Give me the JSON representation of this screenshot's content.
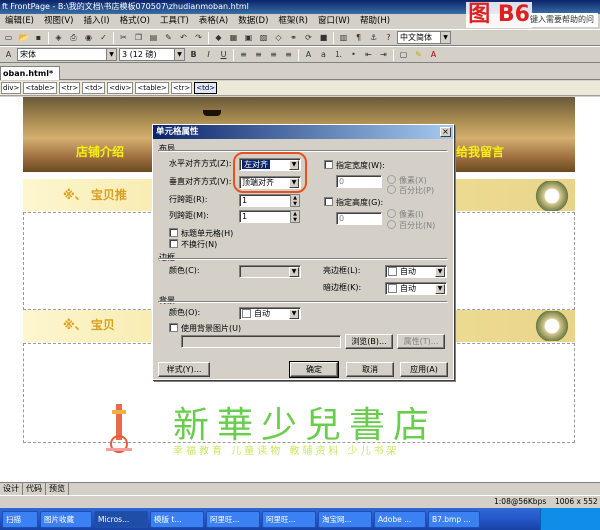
{
  "window": {
    "title": "ft FrontPage - B:\\我的文档\\书店模板070507\\zhudianmoban.html"
  },
  "figure_label": "图 B6",
  "help_box": "键入需要帮助的问",
  "menu": [
    "编辑(E)",
    "视图(V)",
    "插入(I)",
    "格式(O)",
    "工具(T)",
    "表格(A)",
    "数据(D)",
    "框架(R)",
    "窗口(W)",
    "帮助(H)"
  ],
  "toolbar2": {
    "font": "宋体",
    "size": "3 (12 磅)",
    "bold": "B",
    "italic": "I",
    "underline": "U",
    "language": "中文简体"
  },
  "file_tab": "oban.html*",
  "tags": [
    "div>",
    "<table>",
    "<tr>",
    "<td>",
    "<div>",
    "<table>",
    "<tr>",
    "<td>"
  ],
  "page": {
    "nav_left": "店铺介绍",
    "nav_right": "给我留言",
    "strip1": "※、  宝贝推",
    "strip2": "※、  宝贝",
    "store_title": "新華少兒書店",
    "store_slogan": "幸福教育 儿童读物 教辅资料 少儿书架"
  },
  "view_tabs": [
    "设计",
    "代码",
    "预览"
  ],
  "status": {
    "speed": "1:08@56Kbps",
    "size": "1006 x 552"
  },
  "taskbar": [
    "扫描",
    "图片收藏",
    "Micros...",
    "模版 t...",
    "阿里旺...",
    "阿里旺...",
    "淘宝网...",
    "Adobe ...",
    "B7.bmp ..."
  ],
  "dialog": {
    "title": "单元格属性",
    "close": "×",
    "layout_group": "布局",
    "h_align_label": "水平对齐方式(Z):",
    "h_align_value": "左对齐",
    "v_align_label": "垂直对齐方式(V):",
    "v_align_value": "顶端对齐",
    "row_span_label": "行跨距(R):",
    "row_span_value": "1",
    "col_span_label": "列跨距(M):",
    "col_span_value": "1",
    "header_cell": "标题单元格(H)",
    "no_wrap": "不换行(N)",
    "spec_width": "指定宽度(W):",
    "width_value": "0",
    "width_px": "像素(X)",
    "width_pct": "百分比(P)",
    "spec_height": "指定高度(G):",
    "height_value": "0",
    "height_px": "像素(I)",
    "height_pct": "百分比(N)",
    "border_group": "边框",
    "color_label": "颜色(C):",
    "light_border_label": "亮边框(L):",
    "light_border_value": "自动",
    "dark_border_label": "暗边框(K):",
    "dark_border_value": "自动",
    "bg_group": "背景",
    "bg_color_label": "颜色(O):",
    "bg_color_value": "自动",
    "use_bg_image": "使用背景图片(U)",
    "browse": "浏览(B)...",
    "props": "属性(T)...",
    "style": "样式(Y)...",
    "ok": "确定",
    "cancel": "取消",
    "apply": "应用(A)"
  }
}
